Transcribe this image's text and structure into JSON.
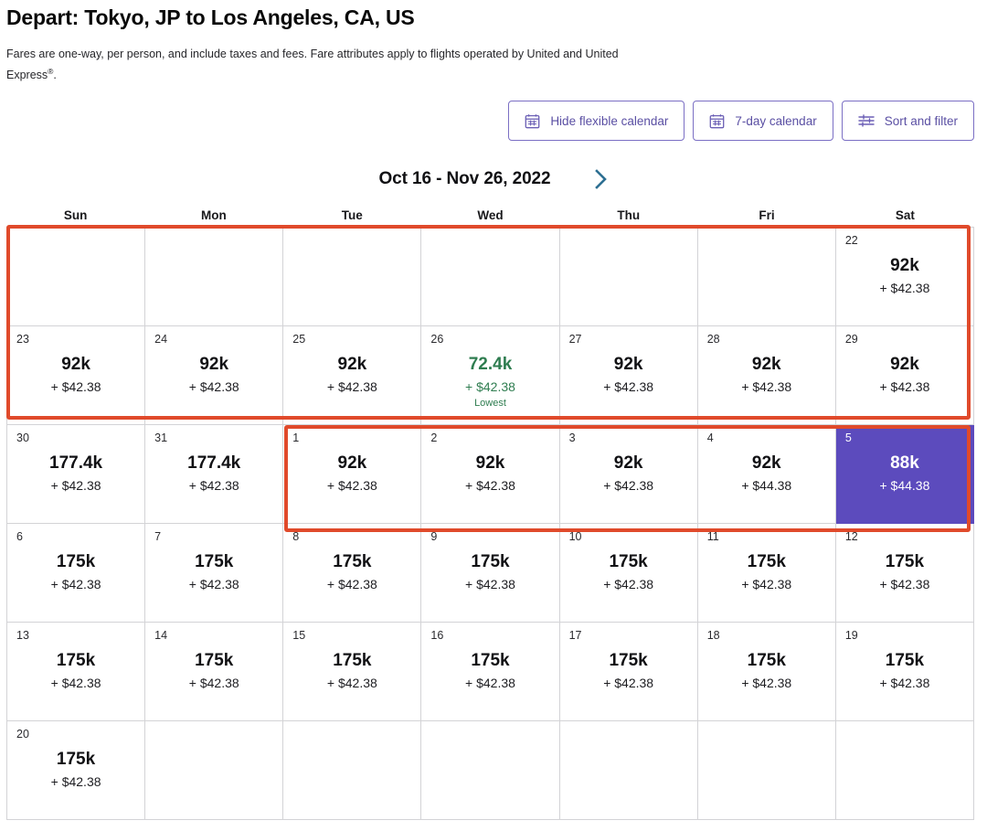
{
  "header": {
    "title": "Depart: Tokyo, JP to Los Angeles, CA, US",
    "note_part1": "Fares are one-way, per person, and include taxes and fees. Fare attributes apply to flights operated by United and United Express",
    "note_sup": "®",
    "note_part2": "."
  },
  "toolbar": {
    "hide_flexible_calendar": "Hide flexible calendar",
    "seven_day_calendar": "7-day calendar",
    "sort_and_filter": "Sort and filter"
  },
  "month_nav": {
    "range_label": "Oct 16 - Nov 26, 2022",
    "next_icon": "chevron-right-icon"
  },
  "weekdays": [
    "Sun",
    "Mon",
    "Tue",
    "Wed",
    "Thu",
    "Fri",
    "Sat"
  ],
  "colors": {
    "accent_purple": "#5c4bbd",
    "button_purple": "#7b6fc4",
    "lowest_green": "#2f7d50",
    "annotation_red": "#e04a2b",
    "grid_line": "#d3d3d6",
    "next_arrow_teal": "#2d6f92"
  },
  "calendar": {
    "cells": [
      {
        "day": "",
        "miles": "",
        "cash": "",
        "tag": "",
        "state": "empty"
      },
      {
        "day": "",
        "miles": "",
        "cash": "",
        "tag": "",
        "state": "empty"
      },
      {
        "day": "",
        "miles": "",
        "cash": "",
        "tag": "",
        "state": "empty"
      },
      {
        "day": "",
        "miles": "",
        "cash": "",
        "tag": "",
        "state": "empty"
      },
      {
        "day": "",
        "miles": "",
        "cash": "",
        "tag": "",
        "state": "empty"
      },
      {
        "day": "",
        "miles": "",
        "cash": "",
        "tag": "",
        "state": "empty"
      },
      {
        "day": "22",
        "miles": "92k",
        "cash": "+ $42.38",
        "tag": "",
        "state": "normal"
      },
      {
        "day": "23",
        "miles": "92k",
        "cash": "+ $42.38",
        "tag": "",
        "state": "normal"
      },
      {
        "day": "24",
        "miles": "92k",
        "cash": "+ $42.38",
        "tag": "",
        "state": "normal"
      },
      {
        "day": "25",
        "miles": "92k",
        "cash": "+ $42.38",
        "tag": "",
        "state": "normal"
      },
      {
        "day": "26",
        "miles": "72.4k",
        "cash": "+ $42.38",
        "tag": "Lowest",
        "state": "lowest"
      },
      {
        "day": "27",
        "miles": "92k",
        "cash": "+ $42.38",
        "tag": "",
        "state": "normal"
      },
      {
        "day": "28",
        "miles": "92k",
        "cash": "+ $42.38",
        "tag": "",
        "state": "normal"
      },
      {
        "day": "29",
        "miles": "92k",
        "cash": "+ $42.38",
        "tag": "",
        "state": "normal"
      },
      {
        "day": "30",
        "miles": "177.4k",
        "cash": "+ $42.38",
        "tag": "",
        "state": "normal"
      },
      {
        "day": "31",
        "miles": "177.4k",
        "cash": "+ $42.38",
        "tag": "",
        "state": "normal"
      },
      {
        "day": "1",
        "miles": "92k",
        "cash": "+ $42.38",
        "tag": "",
        "state": "normal"
      },
      {
        "day": "2",
        "miles": "92k",
        "cash": "+ $42.38",
        "tag": "",
        "state": "normal"
      },
      {
        "day": "3",
        "miles": "92k",
        "cash": "+ $42.38",
        "tag": "",
        "state": "normal"
      },
      {
        "day": "4",
        "miles": "92k",
        "cash": "+ $44.38",
        "tag": "",
        "state": "normal"
      },
      {
        "day": "5",
        "miles": "88k",
        "cash": "+ $44.38",
        "tag": "",
        "state": "selected"
      },
      {
        "day": "6",
        "miles": "175k",
        "cash": "+ $42.38",
        "tag": "",
        "state": "normal"
      },
      {
        "day": "7",
        "miles": "175k",
        "cash": "+ $42.38",
        "tag": "",
        "state": "normal"
      },
      {
        "day": "8",
        "miles": "175k",
        "cash": "+ $42.38",
        "tag": "",
        "state": "normal"
      },
      {
        "day": "9",
        "miles": "175k",
        "cash": "+ $42.38",
        "tag": "",
        "state": "normal"
      },
      {
        "day": "10",
        "miles": "175k",
        "cash": "+ $42.38",
        "tag": "",
        "state": "normal"
      },
      {
        "day": "11",
        "miles": "175k",
        "cash": "+ $42.38",
        "tag": "",
        "state": "normal"
      },
      {
        "day": "12",
        "miles": "175k",
        "cash": "+ $42.38",
        "tag": "",
        "state": "normal"
      },
      {
        "day": "13",
        "miles": "175k",
        "cash": "+ $42.38",
        "tag": "",
        "state": "normal"
      },
      {
        "day": "14",
        "miles": "175k",
        "cash": "+ $42.38",
        "tag": "",
        "state": "normal"
      },
      {
        "day": "15",
        "miles": "175k",
        "cash": "+ $42.38",
        "tag": "",
        "state": "normal"
      },
      {
        "day": "16",
        "miles": "175k",
        "cash": "+ $42.38",
        "tag": "",
        "state": "normal"
      },
      {
        "day": "17",
        "miles": "175k",
        "cash": "+ $42.38",
        "tag": "",
        "state": "normal"
      },
      {
        "day": "18",
        "miles": "175k",
        "cash": "+ $42.38",
        "tag": "",
        "state": "normal"
      },
      {
        "day": "19",
        "miles": "175k",
        "cash": "+ $42.38",
        "tag": "",
        "state": "normal"
      },
      {
        "day": "20",
        "miles": "175k",
        "cash": "+ $42.38",
        "tag": "",
        "state": "normal"
      },
      {
        "day": "",
        "miles": "",
        "cash": "",
        "tag": "",
        "state": "empty"
      },
      {
        "day": "",
        "miles": "",
        "cash": "",
        "tag": "",
        "state": "empty"
      },
      {
        "day": "",
        "miles": "",
        "cash": "",
        "tag": "",
        "state": "empty"
      },
      {
        "day": "",
        "miles": "",
        "cash": "",
        "tag": "",
        "state": "empty"
      },
      {
        "day": "",
        "miles": "",
        "cash": "",
        "tag": "",
        "state": "empty"
      },
      {
        "day": "",
        "miles": "",
        "cash": "",
        "tag": "",
        "state": "empty"
      }
    ]
  },
  "annotations": [
    {
      "name": "highlight-box-weeks-1-2"
    },
    {
      "name": "highlight-box-week-3"
    }
  ]
}
